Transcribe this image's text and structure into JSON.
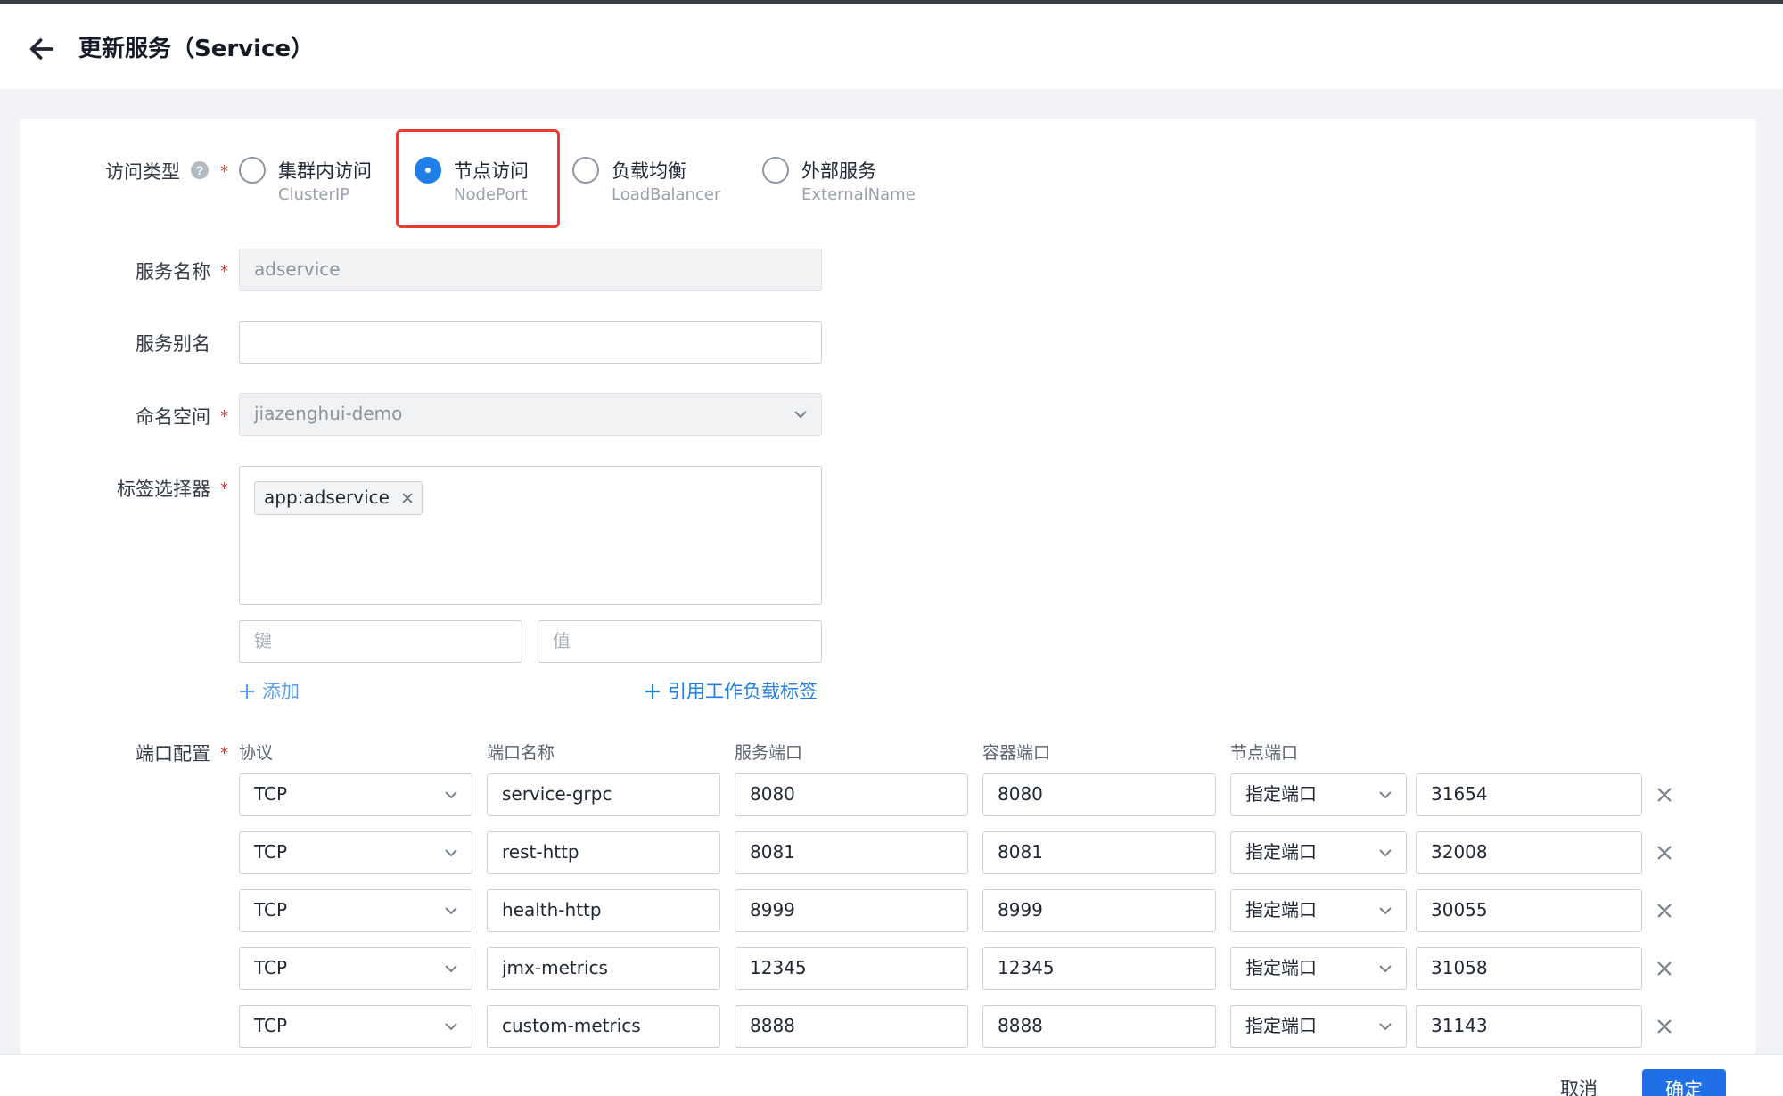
{
  "header": {
    "title": "更新服务（Service）"
  },
  "form": {
    "access_type": {
      "label": "访问类型",
      "options": [
        {
          "main": "集群内访问",
          "sub": "ClusterIP",
          "checked": false
        },
        {
          "main": "节点访问",
          "sub": "NodePort",
          "checked": true
        },
        {
          "main": "负载均衡",
          "sub": "LoadBalancer",
          "checked": false
        },
        {
          "main": "外部服务",
          "sub": "ExternalName",
          "checked": false
        }
      ]
    },
    "service_name": {
      "label": "服务名称",
      "value": "adservice"
    },
    "service_alias": {
      "label": "服务别名",
      "value": ""
    },
    "namespace": {
      "label": "命名空间",
      "value": "jiazenghui-demo"
    },
    "label_selector": {
      "label": "标签选择器",
      "tags": [
        "app:adservice"
      ],
      "key_placeholder": "键",
      "value_placeholder": "值",
      "add_label": "添加",
      "ref_label": "引用工作负载标签"
    },
    "ports": {
      "label": "端口配置",
      "headers": [
        "协议",
        "端口名称",
        "服务端口",
        "容器端口",
        "节点端口"
      ],
      "rows": [
        {
          "protocol": "TCP",
          "name": "service-grpc",
          "service_port": "8080",
          "container_port": "8080",
          "node_mode": "指定端口",
          "node_port": "31654"
        },
        {
          "protocol": "TCP",
          "name": "rest-http",
          "service_port": "8081",
          "container_port": "8081",
          "node_mode": "指定端口",
          "node_port": "32008"
        },
        {
          "protocol": "TCP",
          "name": "health-http",
          "service_port": "8999",
          "container_port": "8999",
          "node_mode": "指定端口",
          "node_port": "30055"
        },
        {
          "protocol": "TCP",
          "name": "jmx-metrics",
          "service_port": "12345",
          "container_port": "12345",
          "node_mode": "指定端口",
          "node_port": "31058"
        },
        {
          "protocol": "TCP",
          "name": "custom-metrics",
          "service_port": "8888",
          "container_port": "8888",
          "node_mode": "指定端口",
          "node_port": "31143"
        }
      ]
    }
  },
  "footer": {
    "cancel_label": "取消",
    "ok_label": "确定"
  },
  "colors": {
    "accent": "#1f7fe6",
    "required": "#e0322b",
    "highlight": "#e63b2e"
  }
}
